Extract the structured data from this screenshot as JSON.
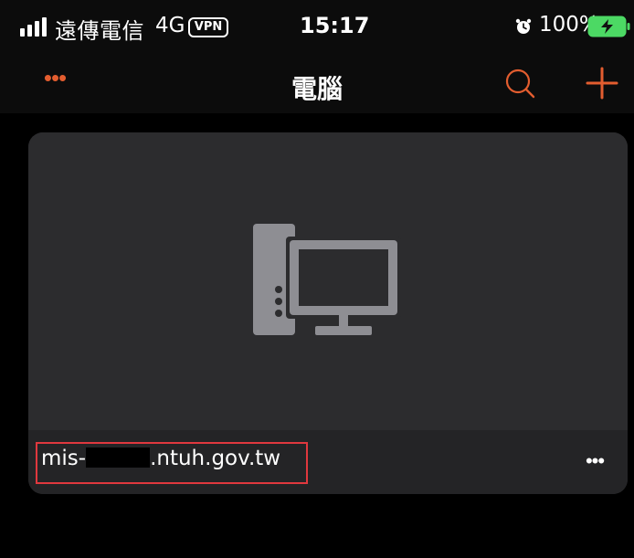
{
  "status_bar": {
    "carrier": "遠傳電信",
    "network": "4G",
    "vpn": "VPN",
    "time": "15:17",
    "alarm_icon": "alarm-icon",
    "battery_percent": "100%",
    "battery_icon": "battery-charging-icon",
    "battery_color": "#4cd964"
  },
  "nav": {
    "more_label": "•••",
    "title": "電腦",
    "search_icon": "search-icon",
    "add_icon": "plus-icon",
    "accent_color": "#e35d2f"
  },
  "computers": [
    {
      "icon": "desktop-computer-icon",
      "host_prefix": "mis-",
      "host_suffix": ".ntuh.gov.tw",
      "more_label": "•••"
    }
  ]
}
